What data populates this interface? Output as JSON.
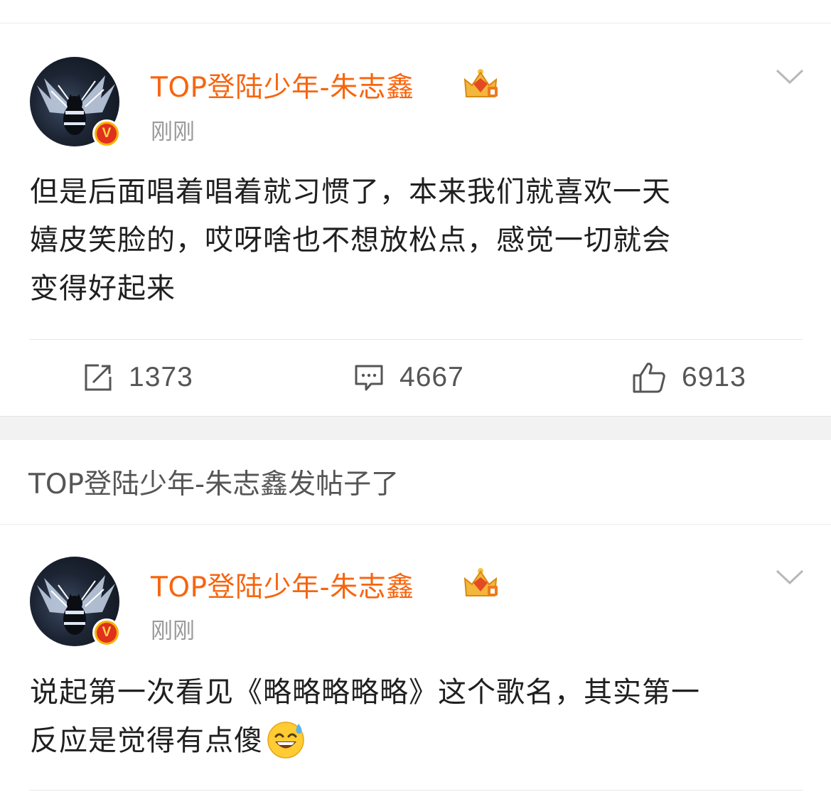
{
  "posts": [
    {
      "username": "TOP登陆少年-朱志鑫",
      "time": "刚刚",
      "content": [
        "但是后面唱着唱着就习惯了，本来我们就喜欢一天",
        "嬉皮笑脸的，哎呀啥也不想放松点，感觉一切就会",
        "变得好起来"
      ],
      "reposts": "1373",
      "comments": "4667",
      "likes": "6913"
    },
    {
      "username": "TOP登陆少年-朱志鑫",
      "time": "刚刚",
      "content": [
        "说起第一次看见《略略略略略》这个歌名，其实第一",
        "反应是觉得有点傻"
      ]
    }
  ],
  "notice": "TOP登陆少年-朱志鑫发帖子了",
  "icons": {
    "verified": "verified-v-badge",
    "vip": "crown-icon",
    "more": "chevron-down-icon",
    "repost": "repost-icon",
    "comment": "comment-icon",
    "like": "thumbs-up-icon",
    "emoji": "sweat-smile-emoji"
  },
  "colors": {
    "username": "#f7650f",
    "time": "#9a9a9a",
    "text": "#1f1f1f"
  }
}
